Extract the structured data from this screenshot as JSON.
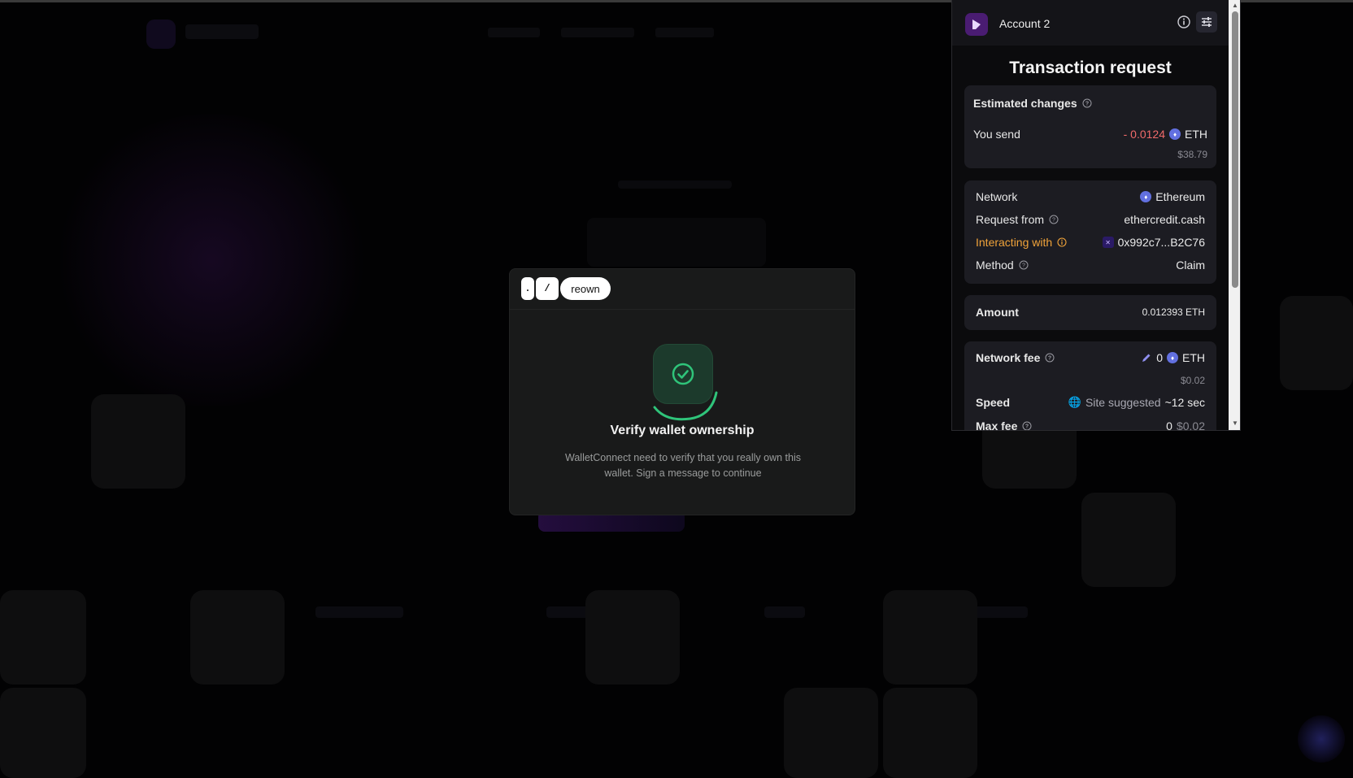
{
  "modal": {
    "breadcrumb": [
      ".",
      "/",
      "reown"
    ],
    "title": "Verify wallet ownership",
    "description": "WalletConnect need to verify that you really own this wallet. Sign a message to continue"
  },
  "wallet": {
    "account_name": "Account 2",
    "title": "Transaction request",
    "estimated_changes": {
      "label": "Estimated changes",
      "you_send_label": "You send",
      "amount": "- 0.0124",
      "token": "ETH",
      "fiat": "$38.79"
    },
    "details": {
      "network_label": "Network",
      "network_value": "Ethereum",
      "request_from_label": "Request from",
      "request_from_value": "ethercredit.cash",
      "interacting_label": "Interacting with",
      "interacting_value": "0x992c7...B2C76",
      "method_label": "Method",
      "method_value": "Claim"
    },
    "amount": {
      "label": "Amount",
      "value": "0.012393 ETH"
    },
    "fee": {
      "network_fee_label": "Network fee",
      "network_fee_value": "0",
      "network_fee_token": "ETH",
      "network_fee_fiat": "$0.02",
      "speed_label": "Speed",
      "speed_source": "Site suggested",
      "speed_value": "~12 sec",
      "max_fee_label": "Max fee",
      "max_fee_value": "0",
      "max_fee_fiat": "$0.02"
    }
  },
  "colors": {
    "negative": "#f06a6a",
    "warning": "#f0a33a",
    "success": "#2fc47a",
    "brand": "#4a1c72"
  }
}
